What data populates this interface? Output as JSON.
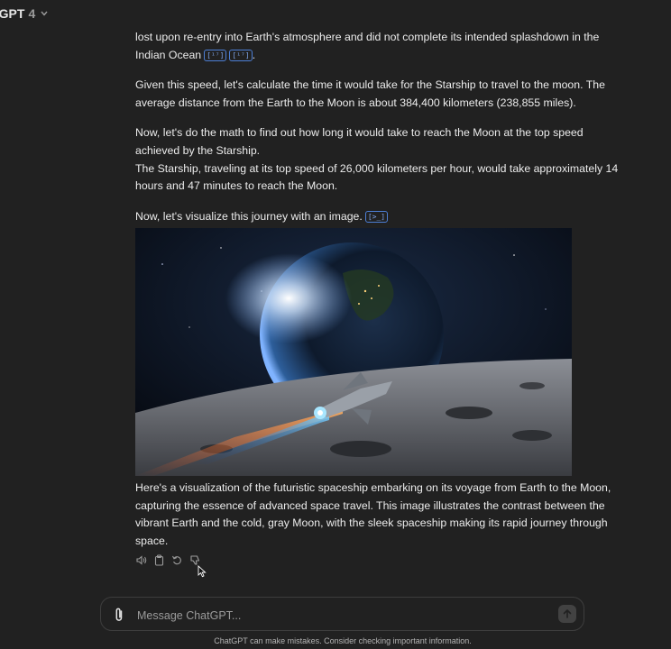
{
  "header": {
    "model_name": "tGPT",
    "model_version": "4"
  },
  "message": {
    "p1": [
      "lost upon re-entry into Earth's atmosphere and did not complete its intended splashdown in the",
      "Indian Ocean"
    ],
    "p1_cites": [
      "[¹⁷]",
      "[¹⁷]"
    ],
    "p1_end": ".",
    "p2": [
      "Given this speed, let's calculate the time it would take for the Starship to travel to the moon. The",
      "average distance from the Earth to the Moon is about 384,400 kilometers (238,855 miles)."
    ],
    "p3": [
      "Now, let's do the math to find out how long it would take to reach the Moon at the top speed",
      "achieved by the Starship.",
      "The Starship, traveling at its top speed of 26,000 kilometers per hour, would take approximately 14",
      "hours and 47 minutes to reach the Moon."
    ],
    "p4": "Now, let's visualize this journey with an image.",
    "p4_cite": "[>_]",
    "caption": [
      "Here's a visualization of the futuristic spaceship embarking on its voyage from Earth to the Moon,",
      "capturing the essence of advanced space travel. This image illustrates the contrast between the",
      "vibrant Earth and the cold, gray Moon, with the sleek spaceship making its rapid journey through",
      "space."
    ]
  },
  "actions": {
    "read_aloud_icon": "speaker-icon",
    "copy_icon": "clipboard-icon",
    "regenerate_icon": "refresh-icon",
    "dislike_icon": "thumbs-down-icon"
  },
  "composer": {
    "placeholder": "Message ChatGPT...",
    "attach_icon": "paperclip-icon",
    "send_icon": "arrow-up-icon"
  },
  "footer": {
    "disclaimer": "ChatGPT can make mistakes. Consider checking important information."
  },
  "colors": {
    "background": "#212121",
    "text": "#ececec",
    "citation": "#4d7fd6"
  }
}
